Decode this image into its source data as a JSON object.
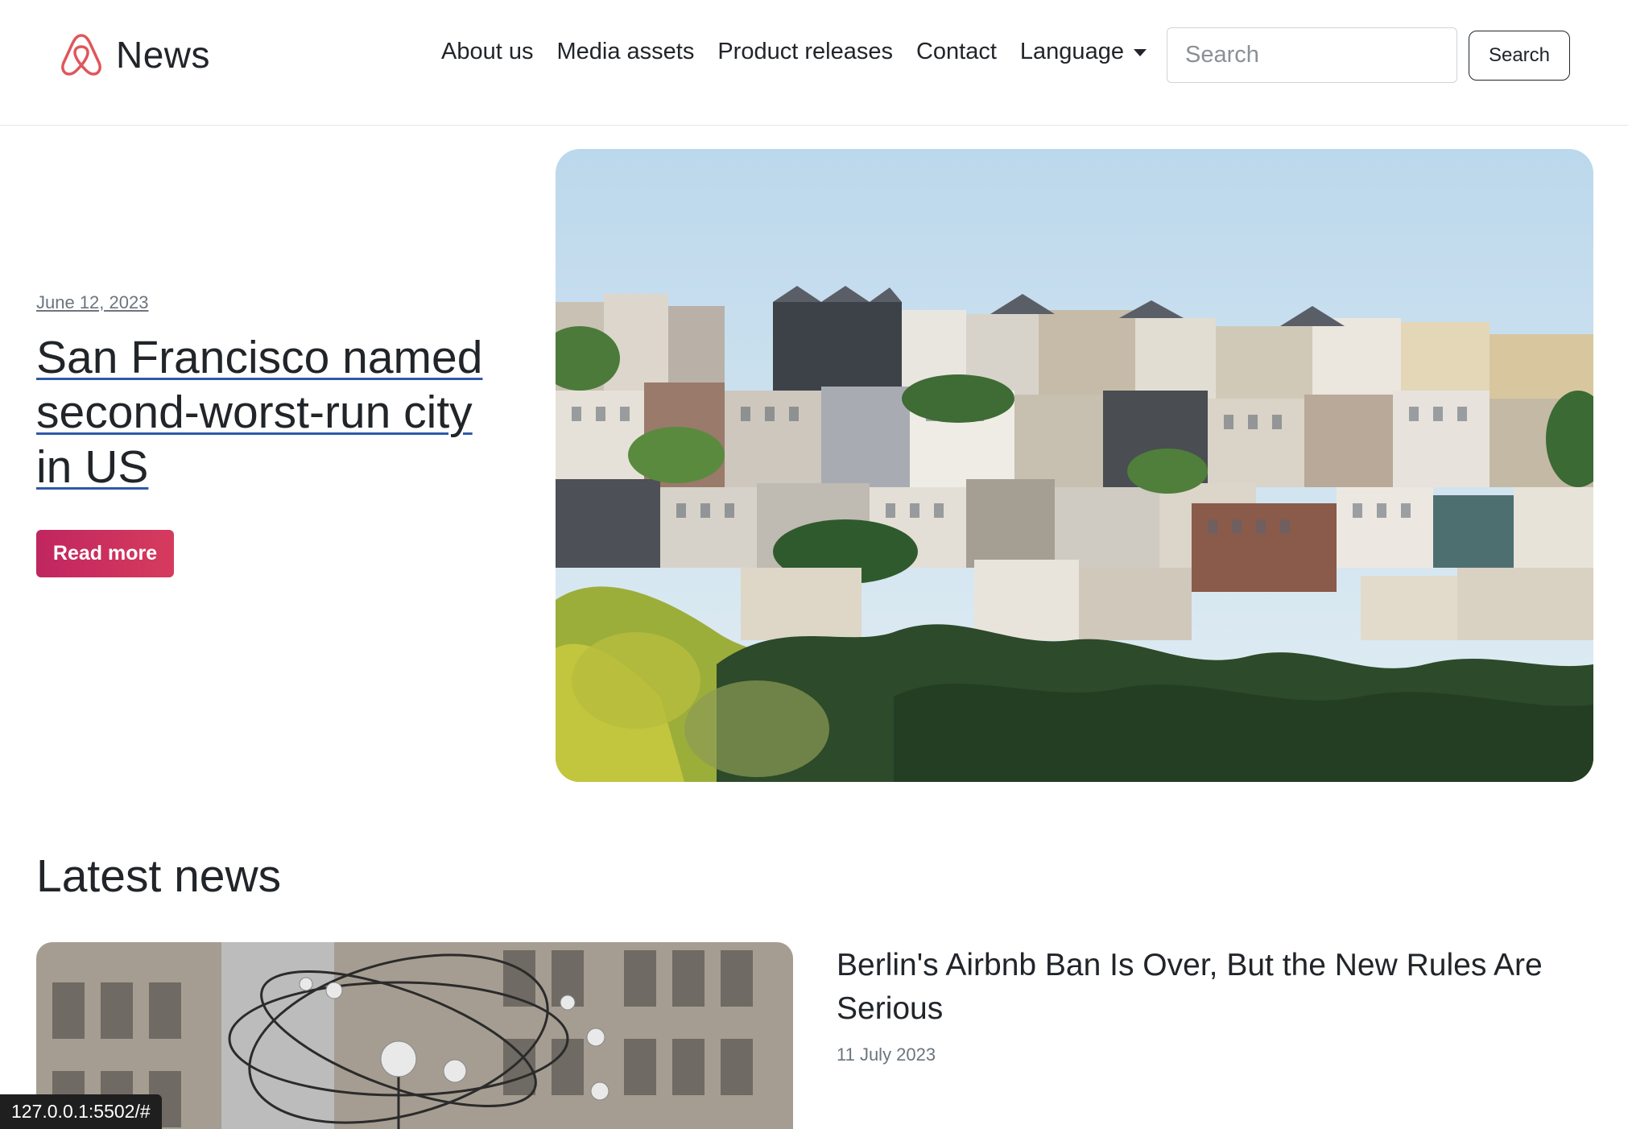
{
  "header": {
    "brand": "News",
    "nav": [
      {
        "label": "About us"
      },
      {
        "label": "Media assets"
      },
      {
        "label": "Product releases"
      },
      {
        "label": "Contact"
      }
    ],
    "language_label": "Language",
    "search_placeholder": "Search",
    "search_button": "Search"
  },
  "hero": {
    "date": "June 12, 2023",
    "title": "San Francisco named second-worst-run city in US",
    "read_more": "Read more"
  },
  "latest": {
    "heading": "Latest news",
    "items": [
      {
        "title": "Berlin's Airbnb Ban Is Over, But the New Rules Are Serious",
        "date": "11 July 2023"
      }
    ]
  },
  "status_url": "127.0.0.1:5502/#",
  "colors": {
    "brand": "#e0565b",
    "button_gradient_start": "#c0265f",
    "button_gradient_end": "#d63b5e",
    "link_underline": "#2f5aa8"
  }
}
